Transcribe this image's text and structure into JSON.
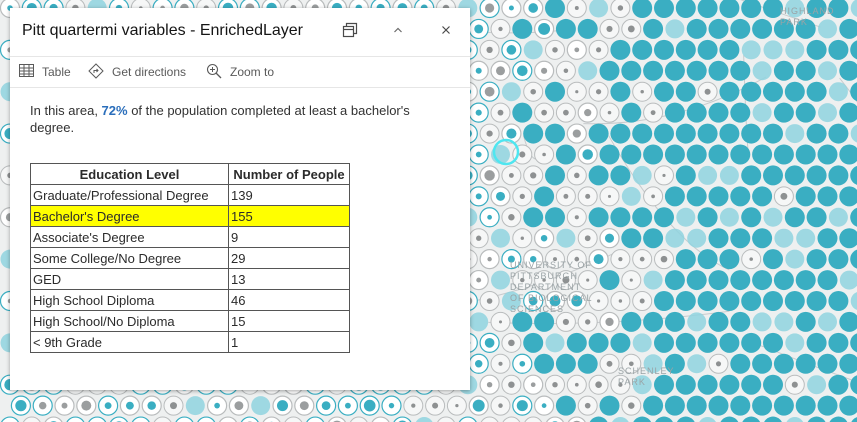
{
  "popup": {
    "title": "Pitt quartermi variables - EnrichedLayer",
    "actions": {
      "table": "Table",
      "directions": "Get directions",
      "zoom": "Zoom to"
    },
    "summary": {
      "prefix": "In this area, ",
      "percent": "72%",
      "suffix": " of the population completed at least a bachelor's degree."
    },
    "table": {
      "headers": [
        "Education Level",
        "Number of People"
      ],
      "rows": [
        {
          "level": "Graduate/Professional Degree",
          "count": "139",
          "highlight": false
        },
        {
          "level": "Bachelor's Degree",
          "count": "155",
          "highlight": true
        },
        {
          "level": "Associate's Degree",
          "count": "9",
          "highlight": false
        },
        {
          "level": "Some College/No Degree",
          "count": "29",
          "highlight": false
        },
        {
          "level": "GED",
          "count": "13",
          "highlight": false
        },
        {
          "level": "High School Diploma",
          "count": "46",
          "highlight": false
        },
        {
          "level": "High School/No Diploma",
          "count": "15",
          "highlight": false
        },
        {
          "level": "< 9th Grade",
          "count": "1",
          "highlight": false
        }
      ]
    }
  },
  "map": {
    "labels": [
      {
        "id": "highland-park",
        "lines": [
          "HIGHLAND",
          "PARK"
        ]
      },
      {
        "id": "pitt-biology",
        "lines": [
          "UNIVERSITY OF",
          "PITTSBURGH",
          "DEPARTMENT",
          "OF BIOLOGICAL",
          "SCIENCES"
        ]
      },
      {
        "id": "schenley-park",
        "lines": [
          "SCHENLEY",
          "PARK"
        ]
      }
    ],
    "colors": {
      "teal": "#3aaec2",
      "teal_light": "#8fd3df",
      "gray_ring": "#b9bcbd",
      "background": "#eef0f0"
    }
  },
  "icons": [
    "dock-icon",
    "chevron-up-icon",
    "close-icon",
    "table-icon",
    "directions-icon",
    "zoom-to-icon"
  ]
}
